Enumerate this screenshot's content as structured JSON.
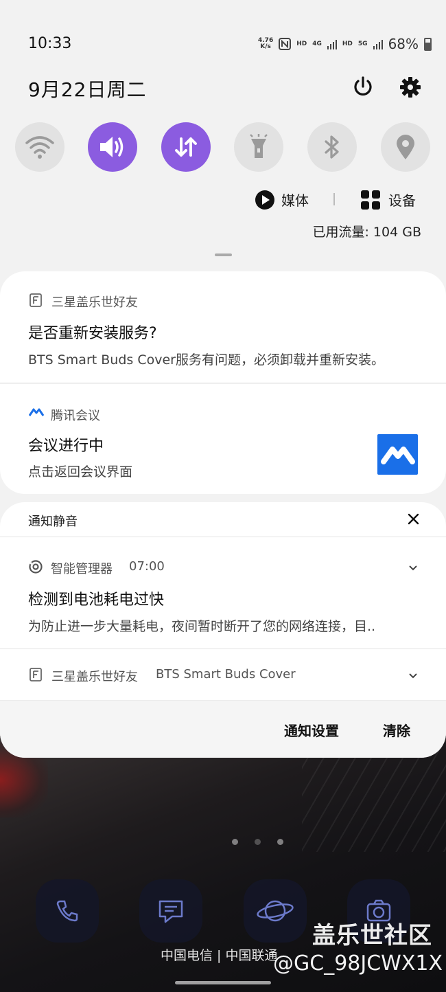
{
  "status_bar": {
    "time": "10:33",
    "net_speed_top": "4.76",
    "net_speed_bottom": "K/s",
    "hd1": "HD",
    "net1": "4G",
    "hd2": "HD",
    "net2": "5G",
    "battery_text": "68%",
    "battery_level": 0.68
  },
  "header": {
    "date": "9月22日周二"
  },
  "quick_settings": {
    "toggles": [
      {
        "name": "wifi-icon",
        "active": false
      },
      {
        "name": "sound-icon",
        "active": true
      },
      {
        "name": "mobile-data-icon",
        "active": true
      },
      {
        "name": "flashlight-icon",
        "active": false
      },
      {
        "name": "bluetooth-icon",
        "active": false
      },
      {
        "name": "location-icon",
        "active": false
      }
    ],
    "accent_color": "#8b5ce0",
    "media_label": "媒体",
    "device_label": "设备",
    "data_usage": "已用流量: 104 GB"
  },
  "notifications": {
    "n1": {
      "app": "三星盖乐世好友",
      "title": "是否重新安装服务?",
      "body": "BTS Smart Buds Cover服务有问题，必须卸载并重新安装。"
    },
    "n2": {
      "app": "腾讯会议",
      "title": "会议进行中",
      "body": "点击返回会议界面"
    },
    "silent_header": "通知静音",
    "n3": {
      "app": "智能管理器",
      "time": "07:00",
      "title": "检测到电池耗电过快",
      "body": "为防止进一步大量耗电，夜间暂时断开了您的网络连接，目.."
    },
    "n4": {
      "app": "三星盖乐世好友",
      "subtitle": "BTS Smart Buds Cover"
    },
    "settings_button": "通知设置",
    "clear_button": "清除"
  },
  "home": {
    "carrier": "中国电信 | 中国联通",
    "watermark_title": "盖乐世社区",
    "watermark_user": "@GC_98JCWX1X"
  }
}
